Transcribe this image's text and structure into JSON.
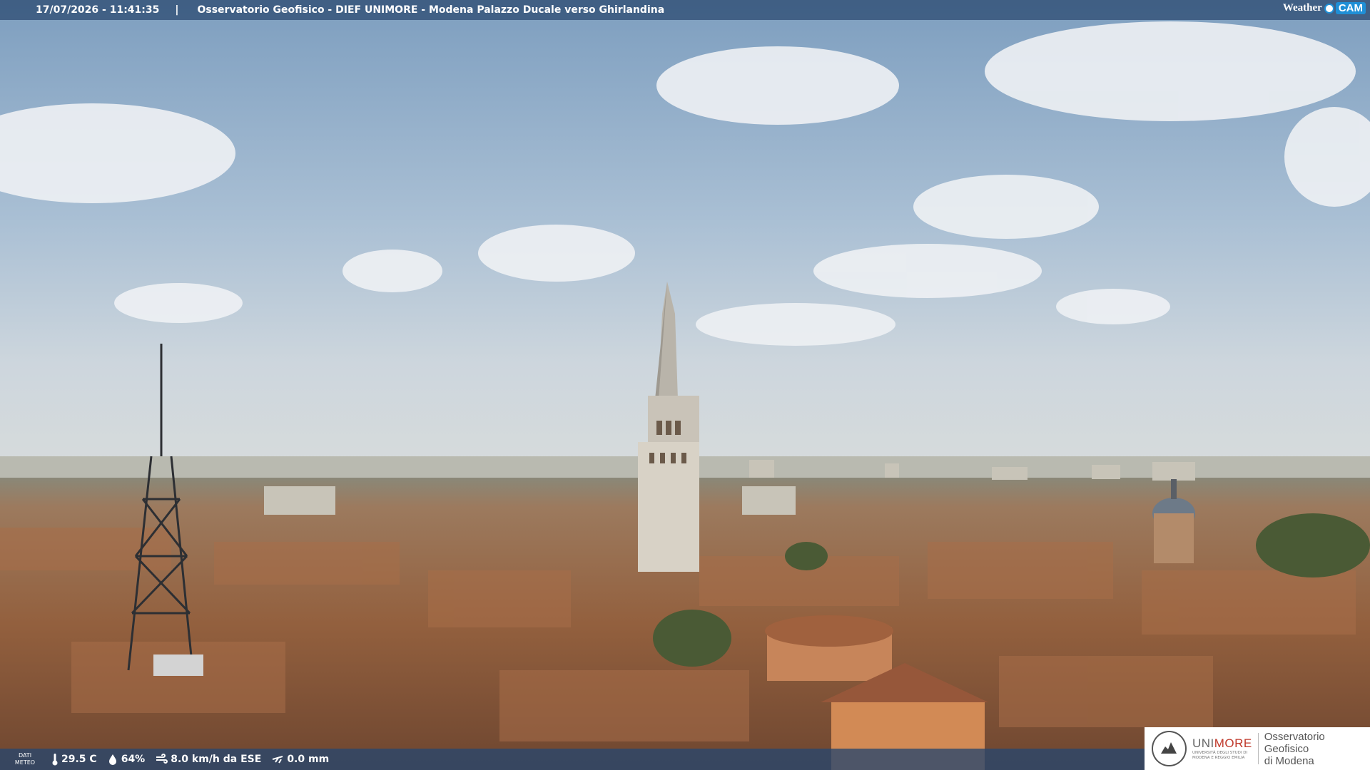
{
  "header": {
    "timestamp": "17/07/2026 - 11:41:35",
    "separator": "|",
    "title": "Osservatorio Geofisico - DIEF UNIMORE - Modena Palazzo Ducale verso Ghirlandina",
    "brand_weather": "Weather",
    "brand_cam": "CAM"
  },
  "weather": {
    "label_line1": "DATI",
    "label_line2": "METEO",
    "temperature": "29.5 C",
    "humidity": "64%",
    "wind": "8.0 km/h da ESE",
    "rain": "0.0 mm"
  },
  "logo": {
    "uni_part1": "UNI",
    "uni_part2": "MORE",
    "uni_sub": "UNIVERSITÀ DEGLI STUDI DI MODENA E REGGIO EMILIA",
    "obs_line1": "Osservatorio Geofisico",
    "obs_line2": "di Modena"
  },
  "icons": [
    "thermometer-icon",
    "humidity-drop-icon",
    "wind-icon",
    "rain-gauge-icon"
  ],
  "colors": {
    "bar": "#284670",
    "brand_cam": "#1f8fd6",
    "unimore_red": "#c0392b"
  }
}
